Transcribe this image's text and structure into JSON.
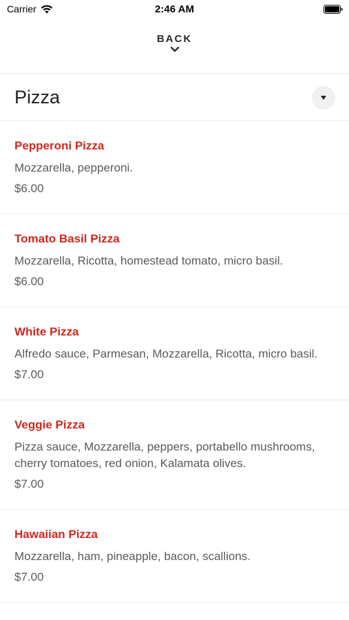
{
  "status_bar": {
    "carrier": "Carrier",
    "time": "2:46 AM"
  },
  "header": {
    "back_label": "BACK"
  },
  "category": {
    "title": "Pizza"
  },
  "menu": {
    "items": [
      {
        "name": "Pepperoni Pizza",
        "description": "Mozzarella, pepperoni.",
        "price": "$6.00"
      },
      {
        "name": "Tomato Basil Pizza",
        "description": "Mozzarella, Ricotta, homestead tomato, micro basil.",
        "price": "$6.00"
      },
      {
        "name": "White Pizza",
        "description": "Alfredo sauce, Parmesan, Mozzarella, Ricotta, micro basil.",
        "price": "$7.00"
      },
      {
        "name": "Veggie Pizza",
        "description": "Pizza sauce, Mozzarella, peppers, portabello mushrooms, cherry tomatoes, red onion, Kalamata olives.",
        "price": "$7.00"
      },
      {
        "name": "Hawaiian Pizza",
        "description": "Mozzarella, ham, pineapple, bacon, scallions.",
        "price": "$7.00"
      }
    ]
  },
  "colors": {
    "accent": "#d0281e",
    "text": "#5a5a5a",
    "divider": "#ececec"
  }
}
